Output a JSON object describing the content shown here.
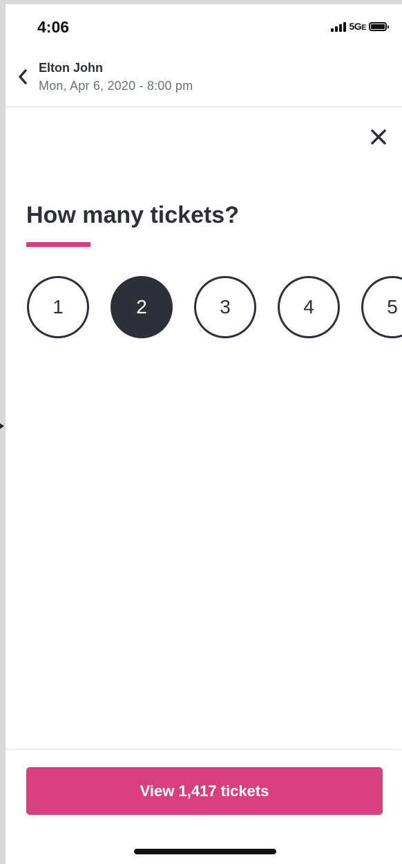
{
  "status_bar": {
    "time": "4:06",
    "network": "5G",
    "network_suffix": "E"
  },
  "header": {
    "event_name": "Elton John",
    "event_date": "Mon, Apr 6, 2020 - 8:00 pm",
    "back_icon": "chevron-left-icon"
  },
  "modal": {
    "close_icon": "close-icon",
    "title": "How many tickets?",
    "quantities": [
      "1",
      "2",
      "3",
      "4",
      "5"
    ],
    "selected_quantity": "2"
  },
  "footer": {
    "button_label": "View 1,417 tickets"
  },
  "colors": {
    "accent": "#d8407d",
    "dark": "#2d3039",
    "muted": "#6b6f78"
  }
}
